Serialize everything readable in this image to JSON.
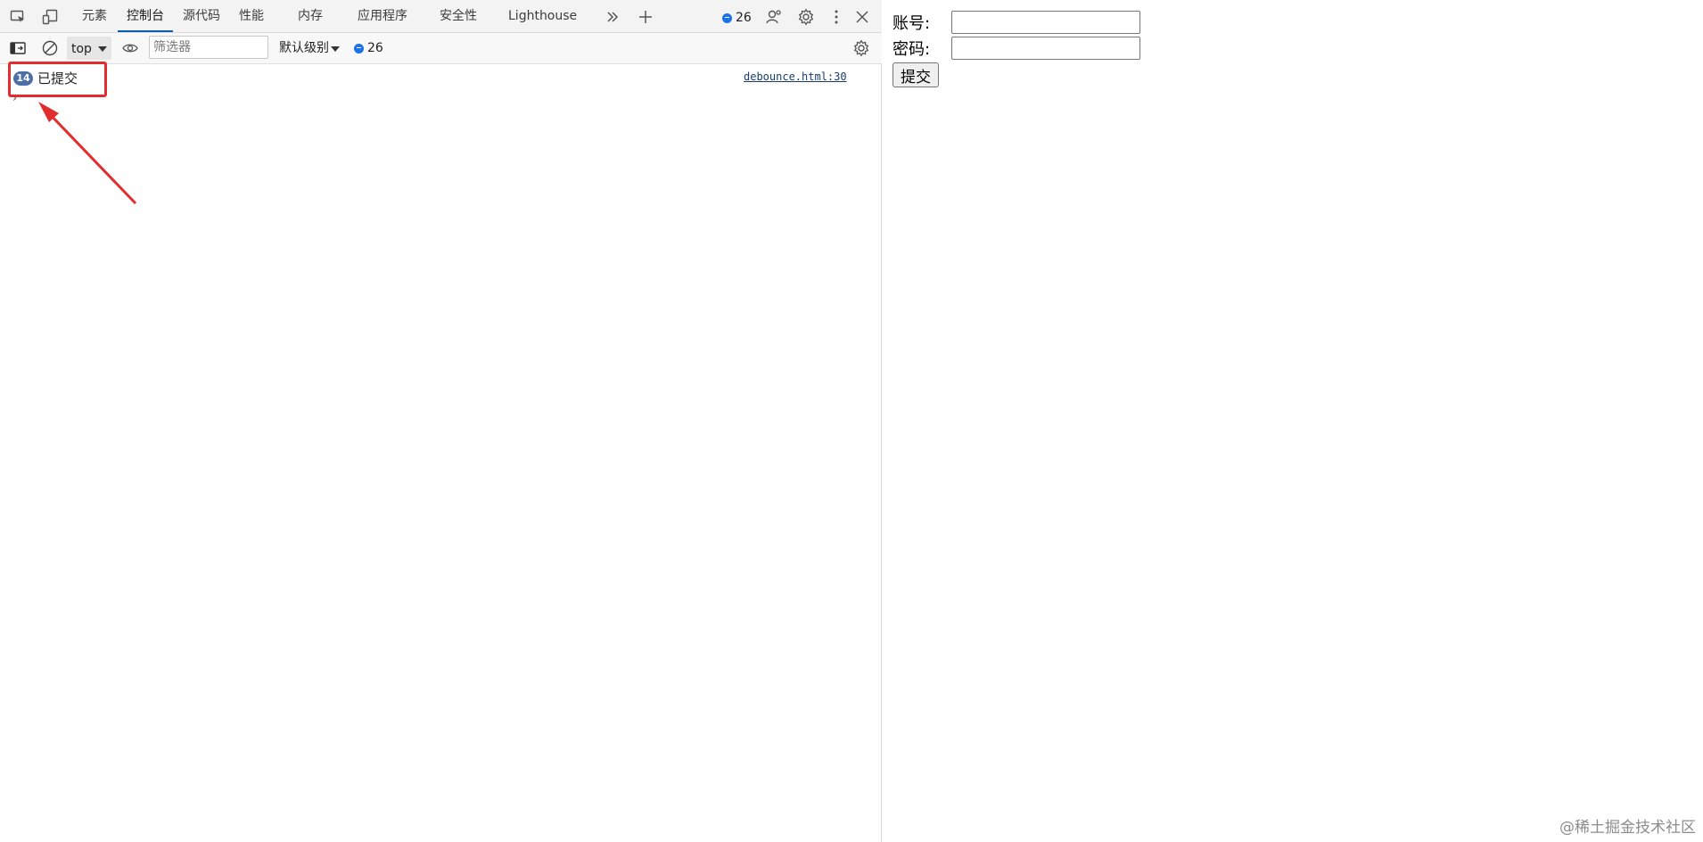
{
  "devtools": {
    "tabs": [
      {
        "label": "元素"
      },
      {
        "label": "控制台",
        "active": true
      },
      {
        "label": "源代码"
      },
      {
        "label": "性能"
      },
      {
        "label": "内存"
      },
      {
        "label": "应用程序"
      },
      {
        "label": "安全性"
      },
      {
        "label": "Lighthouse"
      }
    ],
    "issues_count": "26",
    "toolbar": {
      "context": "top",
      "filter_placeholder": "筛选器",
      "level": "默认级别",
      "issues_count": "26"
    },
    "console": {
      "repeat_count": "14",
      "message": "已提交",
      "source": "debounce.html:30"
    }
  },
  "page": {
    "account_label": "账号:",
    "password_label": "密码:",
    "submit_label": "提交",
    "watermark": "@稀土掘金技术社区"
  },
  "colors": {
    "highlight": "#e12d2d",
    "accent": "#1a73e8"
  }
}
